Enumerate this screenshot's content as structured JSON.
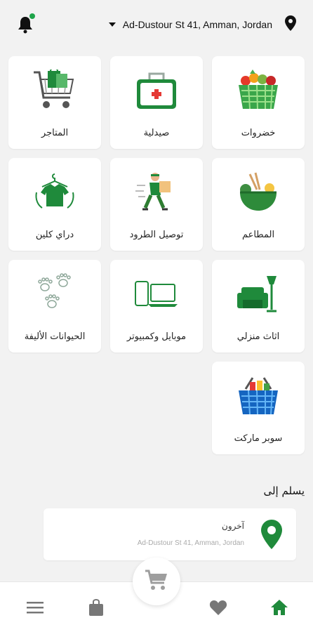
{
  "header": {
    "address": "Ad-Dustour St 41, Amman, Jordan",
    "bell_icon": "bell-icon",
    "location_icon": "location-pin-icon"
  },
  "categories": [
    {
      "label": "خضروات",
      "icon": "vegetable-basket-icon"
    },
    {
      "label": "صيدلية",
      "icon": "first-aid-kit-icon"
    },
    {
      "label": "المتاجر",
      "icon": "shopping-cart-icon"
    },
    {
      "label": "المطاعم",
      "icon": "food-bowl-icon"
    },
    {
      "label": "توصيل الطرود",
      "icon": "delivery-person-icon"
    },
    {
      "label": "دراي كلين",
      "icon": "laundry-shirt-icon"
    },
    {
      "label": "اثاث منزلي",
      "icon": "armchair-lamp-icon"
    },
    {
      "label": "موبايل وكمبيوتر",
      "icon": "phone-laptop-icon"
    },
    {
      "label": "الحيوانات الأليفة",
      "icon": "paw-prints-icon"
    },
    {
      "label": "سوبر ماركت",
      "icon": "grocery-basket-icon"
    }
  ],
  "deliver_to": {
    "title": "يسلم إلى",
    "name": "آخرون",
    "address": "Ad-Dustour St 41, Amman, Jordan"
  },
  "bottom_nav": {
    "items": [
      "home-icon",
      "heart-icon",
      "cart-icon",
      "bag-icon",
      "menu-icon"
    ]
  },
  "colors": {
    "accent": "#1f8a3b",
    "background": "#f2f2f2"
  }
}
